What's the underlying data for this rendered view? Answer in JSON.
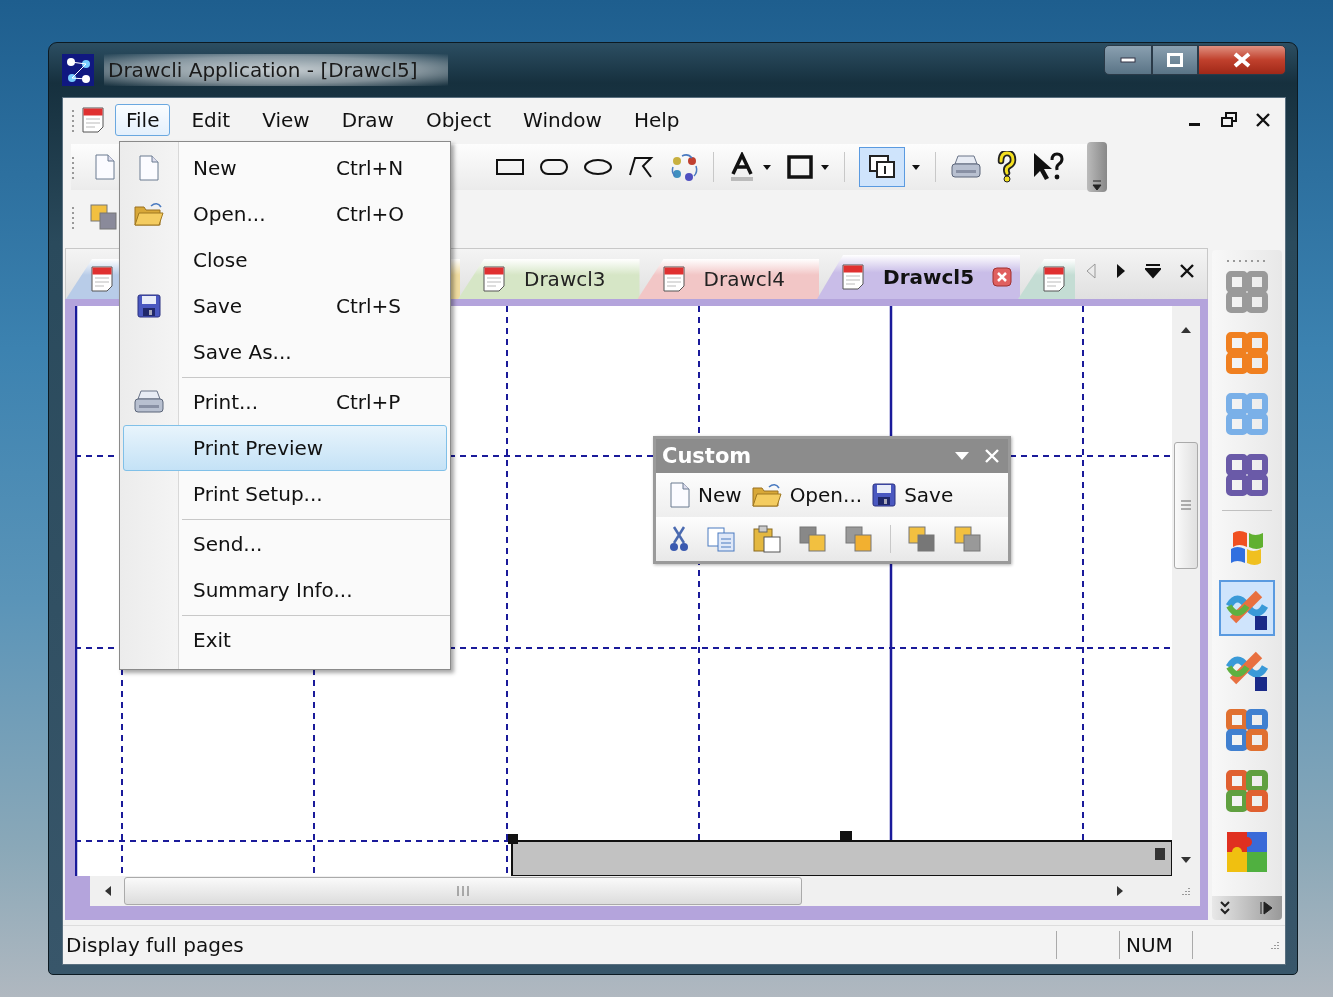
{
  "window": {
    "title": "Drawcli Application - [Drawcl5]"
  },
  "menu_bar": [
    {
      "label": "File",
      "selected": true
    },
    {
      "label": "Edit",
      "selected": false
    },
    {
      "label": "View",
      "selected": false
    },
    {
      "label": "Draw",
      "selected": false
    },
    {
      "label": "Object",
      "selected": false
    },
    {
      "label": "Window",
      "selected": false
    },
    {
      "label": "Help",
      "selected": false
    }
  ],
  "toolbar": {
    "page_view_pressed": true
  },
  "file_menu": [
    {
      "kind": "item",
      "label": "New",
      "shortcut": "Ctrl+N",
      "selected": false
    },
    {
      "kind": "item",
      "label": "Open...",
      "shortcut": "Ctrl+O",
      "selected": false
    },
    {
      "kind": "item",
      "label": "Close",
      "selected": false
    },
    {
      "kind": "item",
      "label": "Save",
      "shortcut": "Ctrl+S",
      "selected": false
    },
    {
      "kind": "item",
      "label": "Save As...",
      "selected": false
    },
    {
      "kind": "separator"
    },
    {
      "kind": "item",
      "label": "Print...",
      "shortcut": "Ctrl+P",
      "selected": false
    },
    {
      "kind": "item",
      "label": "Print Preview",
      "selected": true
    },
    {
      "kind": "item",
      "label": "Print Setup...",
      "selected": false
    },
    {
      "kind": "separator"
    },
    {
      "kind": "item",
      "label": "Send...",
      "selected": false
    },
    {
      "kind": "item",
      "label": "Summary Info...",
      "selected": false
    },
    {
      "kind": "separator"
    },
    {
      "kind": "item",
      "label": "Exit",
      "selected": false
    }
  ],
  "tabs": [
    {
      "color": "#b8cce8",
      "selected": false,
      "has_icon": true
    },
    {
      "color": "#f0dca0",
      "selected": false
    },
    {
      "label": "Drawcl3",
      "color": "#d6e6c6",
      "selected": false,
      "has_icon": true
    },
    {
      "label": "Drawcl4",
      "color": "#f2c6c6",
      "selected": false,
      "has_icon": true
    },
    {
      "label": "Drawcl5",
      "color": "#c9bde8",
      "selected": true,
      "has_icon": true
    },
    {
      "color": "#c4ddd4",
      "selected": false,
      "has_icon": true
    }
  ],
  "custom_toolbar": {
    "title": "Custom",
    "buttons": [
      "New",
      "Open...",
      "Save"
    ]
  },
  "side_toolbar": [
    {
      "selected": false
    },
    {
      "selected": false
    },
    {
      "selected": false
    },
    {
      "selected": false
    },
    {
      "selected": false
    },
    {
      "selected": true
    },
    {
      "selected": false
    },
    {
      "selected": false
    },
    {
      "selected": false
    },
    {
      "selected": false
    }
  ],
  "status_bar": {
    "message": "Display full pages",
    "indicator": "NUM"
  }
}
